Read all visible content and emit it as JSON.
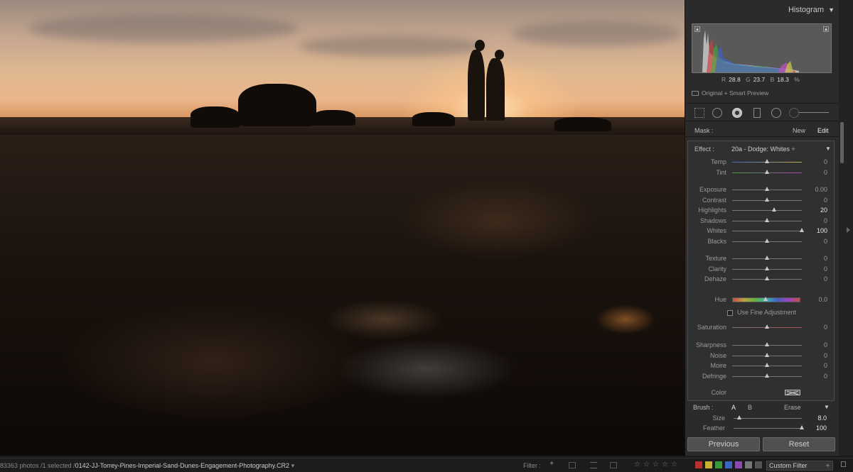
{
  "histogram": {
    "title": "Histogram",
    "readout": {
      "r_label": "R",
      "r": "28.8",
      "g_label": "G",
      "g": "23.7",
      "b_label": "B",
      "b": "18.3",
      "unit": "%"
    },
    "preview": "Original + Smart Preview"
  },
  "mask": {
    "label": "Mask :",
    "new": "New",
    "edit": "Edit"
  },
  "effect": {
    "label": "Effect :",
    "value": "20a - Dodge: Whites ÷"
  },
  "sliders_wb": [
    {
      "name": "Temp",
      "value": "0",
      "pos": 0.5,
      "track": "temp"
    },
    {
      "name": "Tint",
      "value": "0",
      "pos": 0.5,
      "track": "tint"
    }
  ],
  "sliders_tone": [
    {
      "name": "Exposure",
      "value": "0.00",
      "pos": 0.5
    },
    {
      "name": "Contrast",
      "value": "0",
      "pos": 0.5
    },
    {
      "name": "Highlights",
      "value": "20",
      "pos": 0.6,
      "hi": true
    },
    {
      "name": "Shadows",
      "value": "0",
      "pos": 0.5
    },
    {
      "name": "Whites",
      "value": "100",
      "pos": 1.0,
      "hi": true
    },
    {
      "name": "Blacks",
      "value": "0",
      "pos": 0.5
    }
  ],
  "sliders_presence": [
    {
      "name": "Texture",
      "value": "0",
      "pos": 0.5
    },
    {
      "name": "Clarity",
      "value": "0",
      "pos": 0.5
    },
    {
      "name": "Dehaze",
      "value": "0",
      "pos": 0.5
    }
  ],
  "hue": {
    "name": "Hue",
    "value": "0.0",
    "fine_label": "Use Fine Adjustment"
  },
  "saturation": {
    "name": "Saturation",
    "value": "0",
    "pos": 0.5
  },
  "sliders_detail": [
    {
      "name": "Sharpness",
      "value": "0",
      "pos": 0.5
    },
    {
      "name": "Noise",
      "value": "0",
      "pos": 0.5
    },
    {
      "name": "Moire",
      "value": "0",
      "pos": 0.5
    },
    {
      "name": "Defringe",
      "value": "0",
      "pos": 0.5
    }
  ],
  "color": {
    "name": "Color"
  },
  "brush": {
    "label": "Brush :",
    "a": "A",
    "b": "B",
    "erase": "Erase",
    "size_label": "Size",
    "size": "8.0",
    "size_pos": 0.08,
    "feather_label": "Feather",
    "feather": "100",
    "feather_pos": 1.0
  },
  "buttons": {
    "previous": "Previous",
    "reset": "Reset"
  },
  "status": {
    "count": "83363 photos /1 selected /",
    "filename": "0142-JJ-Torrey-Pines-Imperial-Sand-Dunes-Engagement-Photography.CR2",
    "filter_label": "Filter :",
    "stars": [
      "☆",
      "☆",
      "☆",
      "☆",
      "☆"
    ],
    "custom_filter": "Custom Filter",
    "label_colors": [
      "#b8312f",
      "#c8b030",
      "#3a9a3a",
      "#3a66c0",
      "#8a4ab0",
      "#777777",
      "#555555"
    ]
  }
}
